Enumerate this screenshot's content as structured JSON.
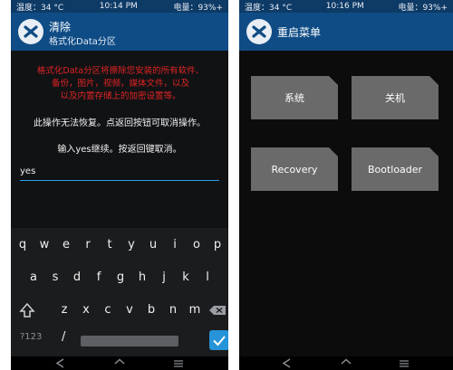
{
  "left": {
    "status": {
      "temp": "温度：34 °C",
      "time": "10:14 PM",
      "battery": "电量：93%+"
    },
    "header": {
      "title": "清除",
      "subtitle": "格式化Data分区"
    },
    "warning_lines": [
      "格式化Data分区将擦除您安装的所有软件、",
      "备份，图片，视频，媒体文件，以及",
      "以及内置存储上的加密设置等。"
    ],
    "info_line1": "此操作无法恢复。点返回按钮可取消操作。",
    "info_line2": "输入yes继续。按返回键取消。",
    "input_value": "yes",
    "keyboard": {
      "row1": [
        "q",
        "w",
        "e",
        "r",
        "t",
        "y",
        "u",
        "i",
        "o",
        "p"
      ],
      "row2": [
        "a",
        "s",
        "d",
        "f",
        "g",
        "h",
        "j",
        "k",
        "l"
      ],
      "row3": [
        "z",
        "x",
        "c",
        "v",
        "b",
        "n",
        "m"
      ],
      "symbols_key": "?123",
      "slash_key": "/"
    }
  },
  "right": {
    "status": {
      "temp": "温度：34 °C",
      "time": "10:16 PM",
      "battery": "电量：93%+"
    },
    "header": {
      "title": "重启菜单"
    },
    "buttons": {
      "system": "系统",
      "poweroff": "关机",
      "recovery": "Recovery",
      "bootloader": "Bootloader"
    }
  },
  "colors": {
    "header": "#0f4c85",
    "status": "#0e3a66",
    "warning": "#e02424",
    "accent": "#2a9df4",
    "button": "#6a6a6a"
  }
}
